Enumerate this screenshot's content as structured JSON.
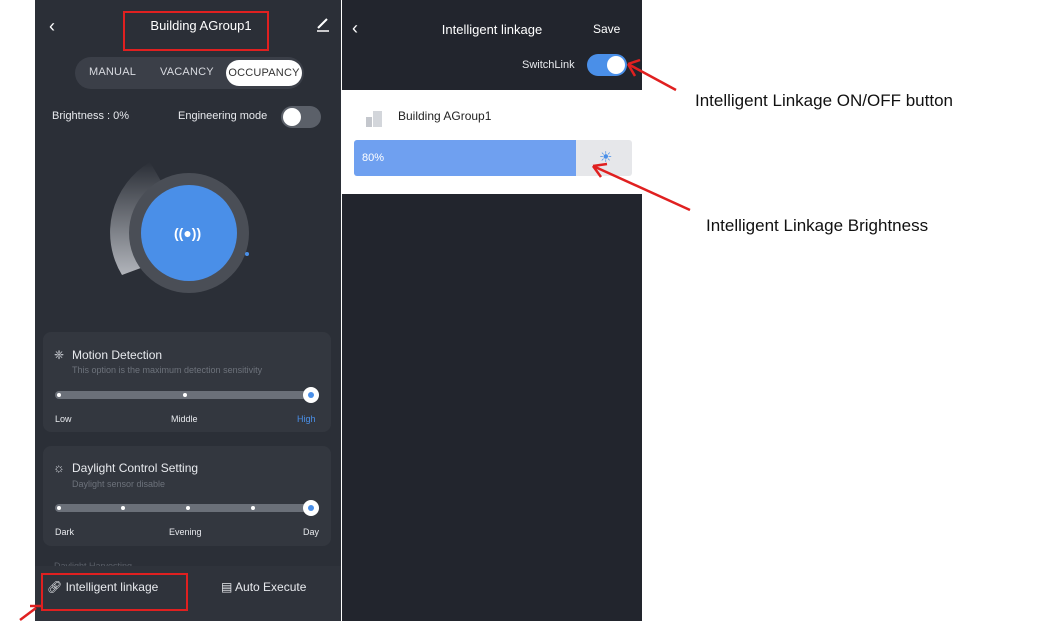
{
  "left_screen": {
    "title": "Building AGroup1",
    "tabs": [
      "MANUAL",
      "VACANCY",
      "OCCUPANCY"
    ],
    "brightness_label": "Brightness : 0%",
    "engineering_mode_label": "Engineering mode",
    "engineering_mode_on": false,
    "motion": {
      "title": "Motion Detection",
      "subtitle": "This option is the maximum detection sensitivity",
      "labels": [
        "Low",
        "Middle",
        "High"
      ],
      "selected": "High"
    },
    "daylight": {
      "title": "Daylight Control Setting",
      "subtitle": "Daylight sensor disable",
      "labels": [
        "Dark",
        "Evening",
        "Day"
      ],
      "selected": "Day"
    },
    "partial_text": "Daylight Harvesting",
    "bottom": {
      "intelligent": "Intelligent linkage",
      "auto": "Auto Execute"
    }
  },
  "right_screen": {
    "title": "Intelligent linkage",
    "save": "Save",
    "switch_label": "SwitchLink",
    "switch_on": true,
    "group_name": "Building AGroup1",
    "brightness_value": "80%",
    "brightness_fraction": 0.8
  },
  "annotations": {
    "onoff": "Intelligent Linkage ON/OFF button",
    "brightness": "Intelligent Linkage Brightness"
  },
  "colors": {
    "accent": "#4a8fe8",
    "highlight": "#e02020",
    "bar_fill": "#6fa0f0"
  }
}
